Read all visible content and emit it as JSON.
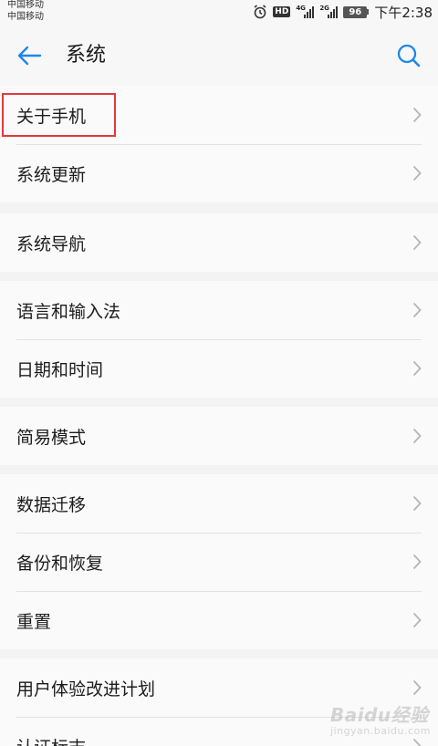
{
  "status_bar": {
    "carrier_1": "中国移动",
    "carrier_2": "中国移动",
    "hd": "HD",
    "network_1": "4G",
    "network_2": "2G",
    "battery": "96",
    "time": "下午2:38"
  },
  "toolbar": {
    "title": "系统",
    "back_icon": "back-arrow-icon",
    "search_icon": "search-icon"
  },
  "groups": [
    {
      "items": [
        {
          "label": "关于手机"
        },
        {
          "label": "系统更新"
        }
      ]
    },
    {
      "items": [
        {
          "label": "系统导航"
        }
      ]
    },
    {
      "items": [
        {
          "label": "语言和输入法"
        },
        {
          "label": "日期和时间"
        }
      ]
    },
    {
      "items": [
        {
          "label": "简易模式"
        }
      ]
    },
    {
      "items": [
        {
          "label": "数据迁移"
        },
        {
          "label": "备份和恢复"
        },
        {
          "label": "重置"
        }
      ]
    },
    {
      "items": [
        {
          "label": "用户体验改进计划"
        },
        {
          "label": "认证标志"
        }
      ]
    }
  ],
  "colors": {
    "accent": "#1e88e5",
    "highlight_box": "#e03a3a",
    "background": "#f3f3f3",
    "row_background": "#fafafa"
  },
  "watermark": {
    "text": "Baidu经验",
    "sub": "jingyan.baidu.com"
  }
}
